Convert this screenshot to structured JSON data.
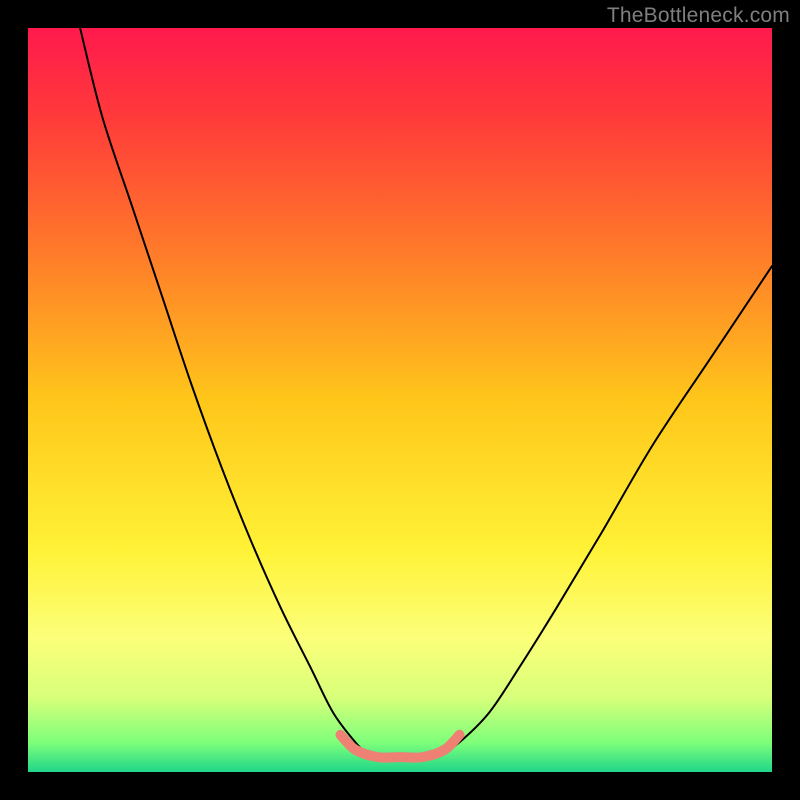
{
  "attribution": "TheBottleneck.com",
  "chart_data": {
    "type": "line",
    "title": "",
    "xlabel": "",
    "ylabel": "",
    "xlim": [
      0,
      100
    ],
    "ylim": [
      0,
      100
    ],
    "background": {
      "type": "vertical-gradient",
      "stops": [
        {
          "pos": 0.0,
          "color": "#ff1a4d"
        },
        {
          "pos": 0.12,
          "color": "#ff3a3a"
        },
        {
          "pos": 0.3,
          "color": "#ff7a2a"
        },
        {
          "pos": 0.5,
          "color": "#ffc61a"
        },
        {
          "pos": 0.7,
          "color": "#fff236"
        },
        {
          "pos": 0.82,
          "color": "#fcff7a"
        },
        {
          "pos": 0.9,
          "color": "#d8ff7a"
        },
        {
          "pos": 0.96,
          "color": "#7fff7a"
        },
        {
          "pos": 1.0,
          "color": "#1fd68a"
        }
      ]
    },
    "series": [
      {
        "name": "curve-left",
        "color": "#000000",
        "stroke_width": 2,
        "x": [
          7,
          10,
          14,
          18,
          22,
          26,
          30,
          34,
          38,
          41,
          44,
          46
        ],
        "values": [
          100,
          88,
          76,
          64,
          52,
          41,
          31,
          22,
          14,
          8,
          4,
          2
        ]
      },
      {
        "name": "curve-right",
        "color": "#000000",
        "stroke_width": 2,
        "x": [
          55,
          58,
          62,
          66,
          71,
          77,
          84,
          92,
          100
        ],
        "values": [
          2,
          4,
          8,
          14,
          22,
          32,
          44,
          56,
          68
        ]
      },
      {
        "name": "bottom-band",
        "color": "#ef8074",
        "stroke_width": 10,
        "x": [
          42,
          44,
          47,
          50,
          53,
          56,
          58
        ],
        "values": [
          5,
          3,
          2,
          2,
          2,
          3,
          5
        ]
      }
    ]
  }
}
